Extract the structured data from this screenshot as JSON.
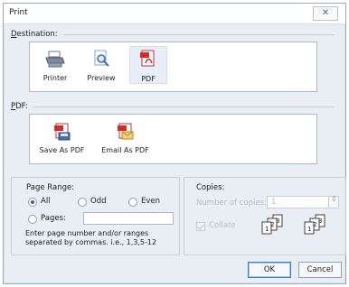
{
  "window": {
    "title": "Print"
  },
  "destination": {
    "label": "Destination:",
    "label_key": "D",
    "label_rest": "estination:",
    "items": [
      {
        "label": "Printer",
        "icon": "printer-icon"
      },
      {
        "label": "Preview",
        "icon": "preview-icon"
      },
      {
        "label": "PDF",
        "icon": "pdf-icon",
        "selected": true
      }
    ]
  },
  "pdf": {
    "label": "PDF:",
    "label_key": "P",
    "label_rest": "DF:",
    "items": [
      {
        "label": "Save As PDF",
        "icon": "save-as-pdf-icon"
      },
      {
        "label": "Email As PDF",
        "icon": "email-as-pdf-icon"
      }
    ]
  },
  "page_range": {
    "label": "Page Range:",
    "options": [
      {
        "label": "All",
        "checked": true
      },
      {
        "label": "Odd",
        "checked": false
      },
      {
        "label": "Even",
        "checked": false
      }
    ],
    "pages_label": "Pages:",
    "pages_value": "",
    "help_line1": "Enter page number and/or ranges",
    "help_line2": "separated by commas.  i.e., 1,3,5-12"
  },
  "copies": {
    "label": "Copies:",
    "number_label": "Number of copies:",
    "number_value": "1",
    "collate_label": "Collate",
    "collate_checked": true
  },
  "buttons": {
    "ok": "OK",
    "cancel": "Cancel"
  },
  "colors": {
    "accent": "#2a62b6",
    "pdf_red": "#d62b2b",
    "window_bg": "#e9eef5"
  }
}
